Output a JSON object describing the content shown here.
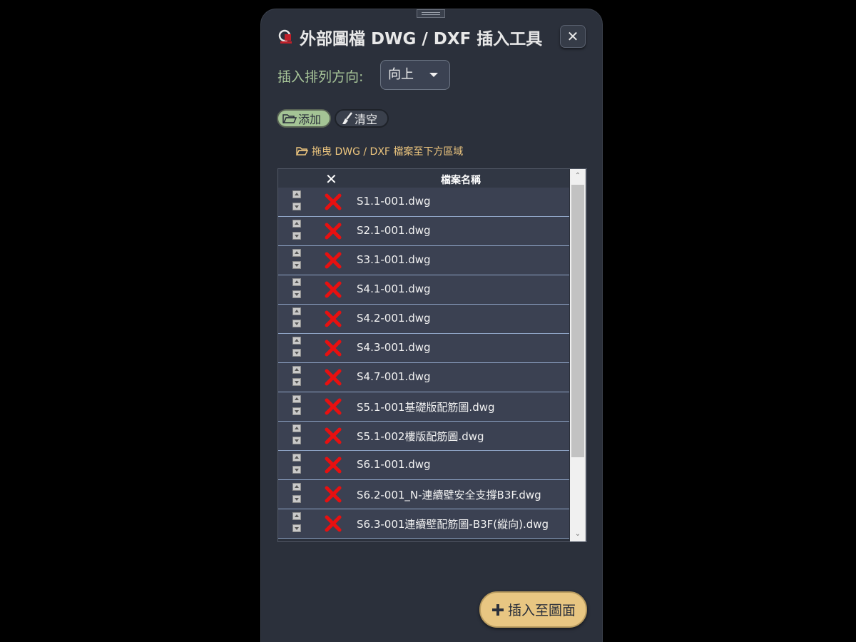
{
  "dialog": {
    "title": "外部圖檔 DWG / DXF 插入工具",
    "close_label": "✕"
  },
  "direction": {
    "label": "插入排列方向:",
    "value": "向上"
  },
  "toolbar": {
    "add_label": "添加",
    "clear_label": "清空"
  },
  "drop_hint": "拖曳 DWG / DXF 檔案至下方區域",
  "table": {
    "delete_header": "✕",
    "name_header": "檔案名稱",
    "rows": [
      {
        "name": "S1.1-001.dwg"
      },
      {
        "name": "S2.1-001.dwg"
      },
      {
        "name": "S3.1-001.dwg"
      },
      {
        "name": "S4.1-001.dwg"
      },
      {
        "name": "S4.2-001.dwg"
      },
      {
        "name": "S4.3-001.dwg"
      },
      {
        "name": "S4.7-001.dwg"
      },
      {
        "name": "S5.1-001基礎版配筋圖.dwg"
      },
      {
        "name": "S5.1-002樓版配筋圖.dwg"
      },
      {
        "name": "S6.1-001.dwg"
      },
      {
        "name": "S6.2-001_N-連續壁安全支撐B3F.dwg"
      },
      {
        "name": "S6.3-001連續壁配筋圖-B3F(縱向).dwg"
      }
    ]
  },
  "insert_label": "插入至圖面",
  "colors": {
    "accent_green": "#a4c495",
    "accent_gold": "#e8c682",
    "delete_red": "#e81010"
  }
}
